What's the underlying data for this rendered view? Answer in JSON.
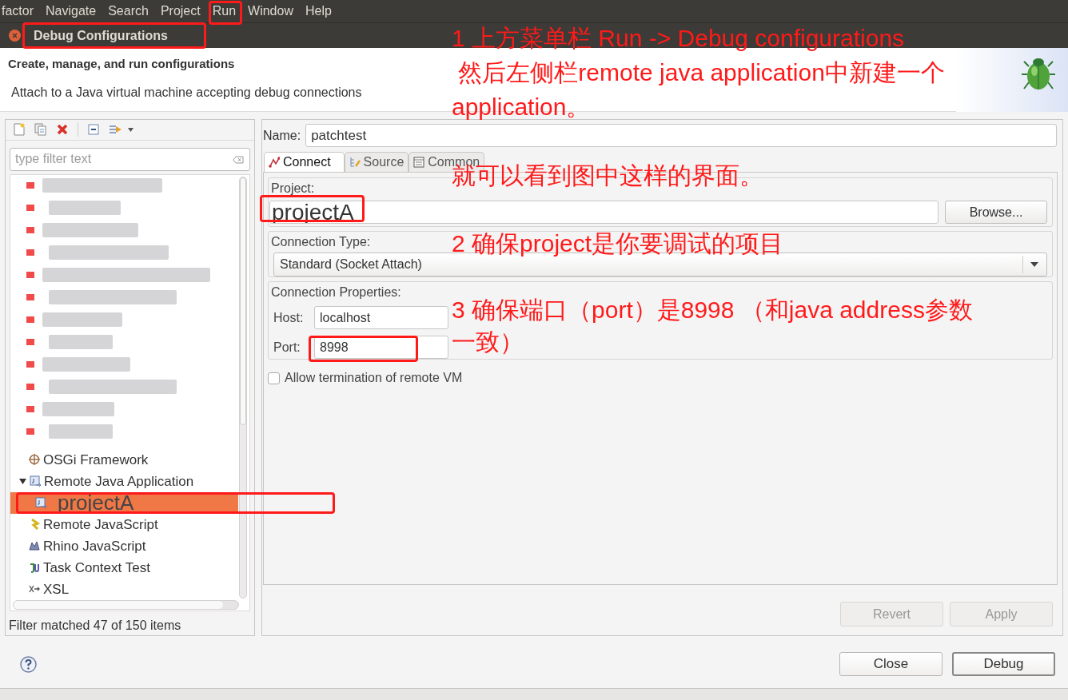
{
  "menu_bar": [
    "factor",
    "Navigate",
    "Search",
    "Project",
    "Run",
    "Window",
    "Help"
  ],
  "dialog": {
    "title": "Debug Configurations",
    "header_title": "Create, manage, and run configurations",
    "header_message": "Attach to a Java virtual machine accepting debug connections"
  },
  "left_panel": {
    "filter_placeholder": "type filter text",
    "status": "Filter matched 47 of 150 items",
    "tree": [
      {
        "label": "OSGi Framework",
        "kind": "osgi",
        "selected": false
      },
      {
        "label": "Remote Java Application",
        "kind": "remote-java",
        "selected": false,
        "expanded": true,
        "children": [
          {
            "label": "projectA",
            "kind": "remote-java",
            "selected": true
          }
        ]
      },
      {
        "label": "Remote JavaScript",
        "kind": "remote-js",
        "selected": false
      },
      {
        "label": "Rhino JavaScript",
        "kind": "rhino",
        "selected": false
      },
      {
        "label": "Task Context Test",
        "kind": "junit",
        "selected": false
      },
      {
        "label": "XSL",
        "kind": "xsl",
        "selected": false
      }
    ]
  },
  "config": {
    "name_label": "Name:",
    "name": "patchtest",
    "tabs": [
      {
        "label": "Connect",
        "kind": "connect",
        "selected": true
      },
      {
        "label": "Source",
        "kind": "source",
        "selected": false
      },
      {
        "label": "Common",
        "kind": "common",
        "selected": false
      }
    ],
    "project_label": "Project:",
    "project": "projectA",
    "browse": "Browse...",
    "connection_type_label": "Connection Type:",
    "connection_type": "Standard (Socket Attach)",
    "connection_properties_label": "Connection Properties:",
    "host_label": "Host:",
    "host": "localhost",
    "port_label": "Port:",
    "port": "8998",
    "allow_termination": {
      "label": "Allow termination of remote VM",
      "checked": false
    },
    "buttons": [
      {
        "label": "Revert",
        "disabled": true
      },
      {
        "label": "Apply",
        "disabled": true
      }
    ]
  },
  "footer_buttons": [
    {
      "label": "Close",
      "default": false
    },
    {
      "label": "Debug",
      "default": true
    }
  ],
  "annotations": [
    {
      "lines": [
        "1 上方菜单栏 Run -> Debug configurations",
        " 然后左侧栏remote java application中新建一个",
        "application。"
      ]
    },
    {
      "lines": [
        "就可以看到图中这样的界面。"
      ]
    },
    {
      "lines": [
        "2 确保project是你要调试的项目"
      ]
    },
    {
      "lines": [
        "3 确保端口（port）是8998 （和java address参数",
        "一致）"
      ]
    }
  ]
}
